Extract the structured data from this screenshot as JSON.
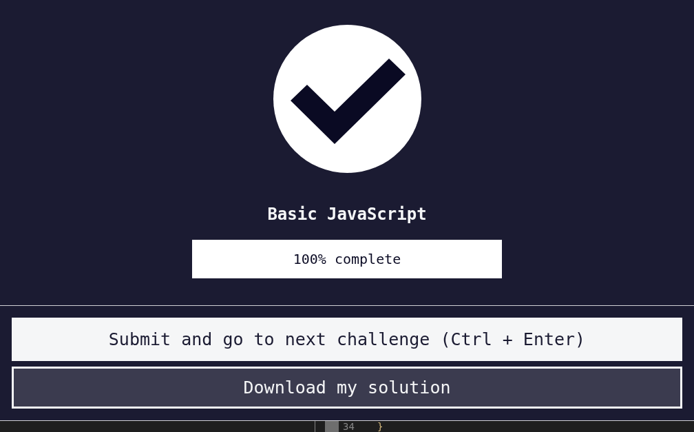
{
  "modal": {
    "title": "Basic JavaScript",
    "progress": {
      "level": 1,
      "label": "100% complete"
    },
    "buttons": [
      {
        "label": "Submit and go to next challenge (Ctrl + Enter)",
        "kind": "primary"
      },
      {
        "label": "Download my solution",
        "kind": "secondary"
      }
    ]
  },
  "editor": {
    "lines": [
      {
        "number": "34",
        "code": "}"
      }
    ]
  }
}
